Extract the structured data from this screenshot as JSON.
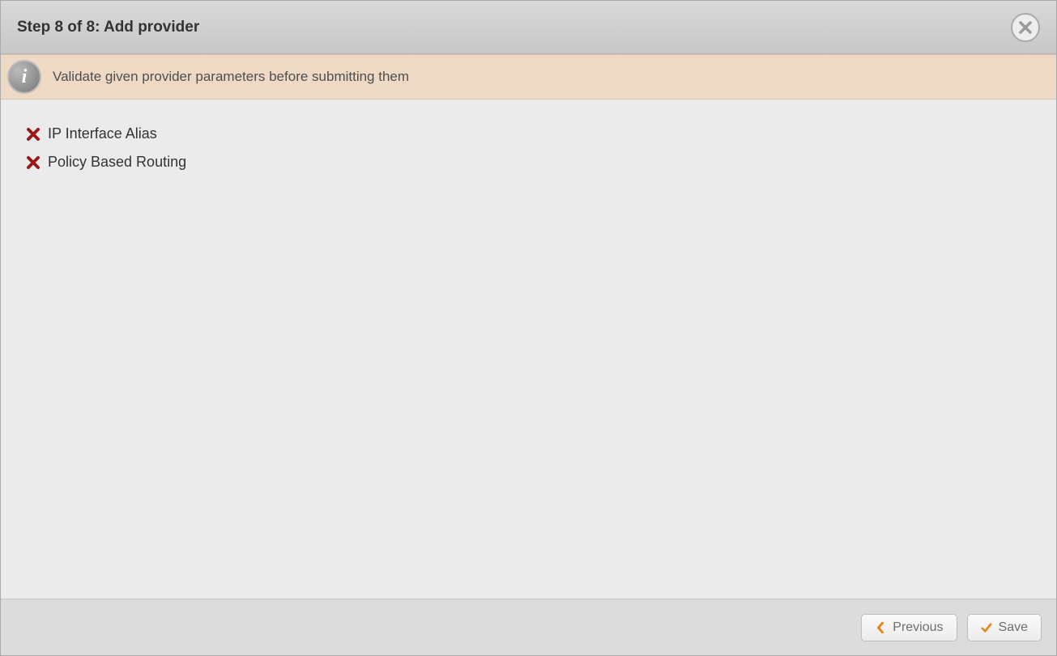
{
  "header": {
    "title": "Step 8 of 8: Add provider"
  },
  "banner": {
    "message": "Validate given provider parameters before submitting them"
  },
  "validation_items": [
    {
      "label": "IP Interface Alias"
    },
    {
      "label": "Policy Based Routing"
    }
  ],
  "footer": {
    "previous_label": "Previous",
    "save_label": "Save"
  }
}
